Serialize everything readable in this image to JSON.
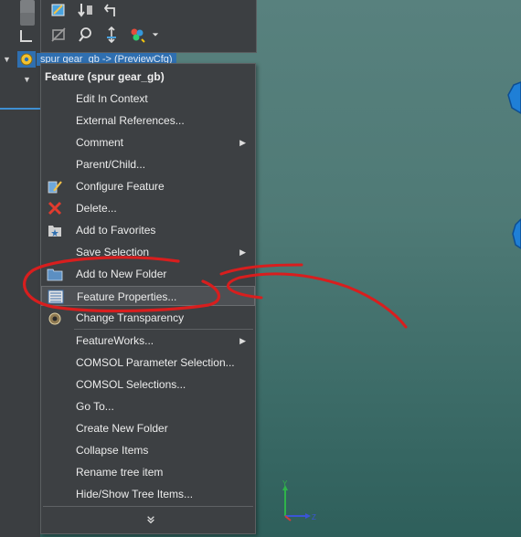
{
  "tree": {
    "selected_item": "spur gear_gb -> (PreviewCfg)"
  },
  "menu": {
    "title": "Feature (spur gear_gb)",
    "items": [
      {
        "label": "Edit In Context",
        "icon": "",
        "submenu": false
      },
      {
        "label": "External References...",
        "icon": "",
        "submenu": false
      },
      {
        "label": "Comment",
        "icon": "",
        "submenu": true
      },
      {
        "label": "Parent/Child...",
        "icon": "",
        "submenu": false
      },
      {
        "label": "Configure Feature",
        "icon": "configure-icon",
        "submenu": false
      },
      {
        "label": "Delete...",
        "icon": "delete-icon",
        "submenu": false
      },
      {
        "label": "Add to Favorites",
        "icon": "favorites-icon",
        "submenu": false
      },
      {
        "label": "Save Selection",
        "icon": "",
        "submenu": true
      },
      {
        "label": "Add to New Folder",
        "icon": "folder-icon",
        "submenu": false
      },
      {
        "label": "Feature Properties...",
        "icon": "properties-icon",
        "submenu": false
      },
      {
        "label": "Change Transparency",
        "icon": "transparency-icon",
        "submenu": false
      },
      {
        "label": "FeatureWorks...",
        "icon": "",
        "submenu": true
      },
      {
        "label": "COMSOL Parameter Selection...",
        "icon": "",
        "submenu": false
      },
      {
        "label": "COMSOL Selections...",
        "icon": "",
        "submenu": false
      },
      {
        "label": "Go To...",
        "icon": "",
        "submenu": false
      },
      {
        "label": "Create New Folder",
        "icon": "",
        "submenu": false
      },
      {
        "label": "Collapse Items",
        "icon": "",
        "submenu": false
      },
      {
        "label": "Rename tree item",
        "icon": "",
        "submenu": false
      },
      {
        "label": "Hide/Show Tree Items...",
        "icon": "",
        "submenu": false
      }
    ],
    "more_icon": "chevron-double-down-icon"
  },
  "triad": {
    "y_label": "Y",
    "z_label": "Z"
  },
  "colors": {
    "accent": "#2f6fb0",
    "annotation": "#d81e1e",
    "viewport": "#4f7a76"
  }
}
